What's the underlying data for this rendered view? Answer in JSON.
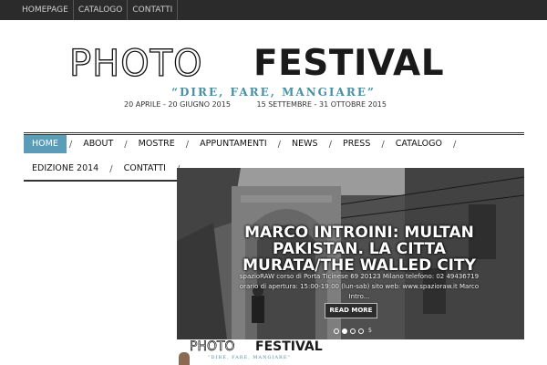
{
  "topbar": {
    "links": [
      "HOMEPAGE",
      "CATALOGO",
      "CONTATTI"
    ]
  },
  "logo": {
    "word1": "PHOTO",
    "word2": "FESTIVAL",
    "tagline": "“DIRE, FARE, MANGIARE”",
    "dates1": "20 APRILE - 20 GIUGNO 2015",
    "dates2": "15 SETTEMBRE - 31 OTTOBRE 2015"
  },
  "nav": {
    "row1": [
      "HOME",
      "ABOUT",
      "MOSTRE",
      "APPUNTAMENTI",
      "NEWS",
      "PRESS",
      "CATALOGO"
    ],
    "row2": [
      "EDIZIONE 2014",
      "CONTATTI"
    ],
    "separator": "/",
    "active_color": "#5b9cb8"
  },
  "slider": {
    "title": "MARCO INTROINI: MULTAN PAKISTAN. LA CITTA MURATA/THE WALLED CITY",
    "text": "spazioRAW corso di Porta Ticinese 69 20123 Milano telefono: 02 49436719 orario di apertura: 15:00-19:00 (lun-sab) sito web: www.spazioraw.it Marco Intro...",
    "button": "READ MORE",
    "active_slide": 2,
    "slide_count": 4,
    "counter": "5"
  },
  "thumbnail": {
    "word1": "PHOTO",
    "word2": "FESTIVAL",
    "tagline": "“DIRE, FARE, MANGIARE”"
  }
}
